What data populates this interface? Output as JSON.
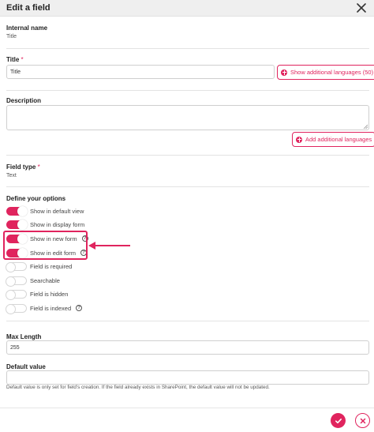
{
  "header": {
    "title": "Edit a field"
  },
  "internal_name": {
    "label": "Internal name",
    "value": "Title"
  },
  "title_field": {
    "label": "Title",
    "required_mark": "*",
    "value": "Title",
    "languages_button": "Show additional languages (50)"
  },
  "description": {
    "label": "Description",
    "value": "",
    "languages_button": "Add additional languages"
  },
  "field_type": {
    "label": "Field type",
    "required_mark": "*",
    "value": "Text"
  },
  "options": {
    "heading": "Define your options",
    "items": [
      {
        "label": "Show in default view",
        "on": true,
        "help": false
      },
      {
        "label": "Show in display form",
        "on": true,
        "help": false
      },
      {
        "label": "Show in new form",
        "on": true,
        "help": true
      },
      {
        "label": "Show in edit form",
        "on": true,
        "help": true
      },
      {
        "label": "Field is required",
        "on": false,
        "help": false
      },
      {
        "label": "Searchable",
        "on": false,
        "help": false
      },
      {
        "label": "Field is hidden",
        "on": false,
        "help": false
      },
      {
        "label": "Field is indexed",
        "on": false,
        "help": true
      }
    ]
  },
  "max_length": {
    "label": "Max Length",
    "value": "255"
  },
  "default_value": {
    "label": "Default value",
    "value": "",
    "note": "Default value is only set for field's creation. If the field already exists in SharePoint, the default value will not be updated."
  },
  "help_glyph": "?",
  "icons": {
    "close": "close-icon",
    "globe": "globe-icon",
    "help": "question-circle-icon",
    "confirm": "check-icon",
    "cancel": "close-icon"
  },
  "colors": {
    "accent": "#e0245e",
    "header_bg": "#efefef",
    "toggle_off_border": "#d6d6d6"
  }
}
